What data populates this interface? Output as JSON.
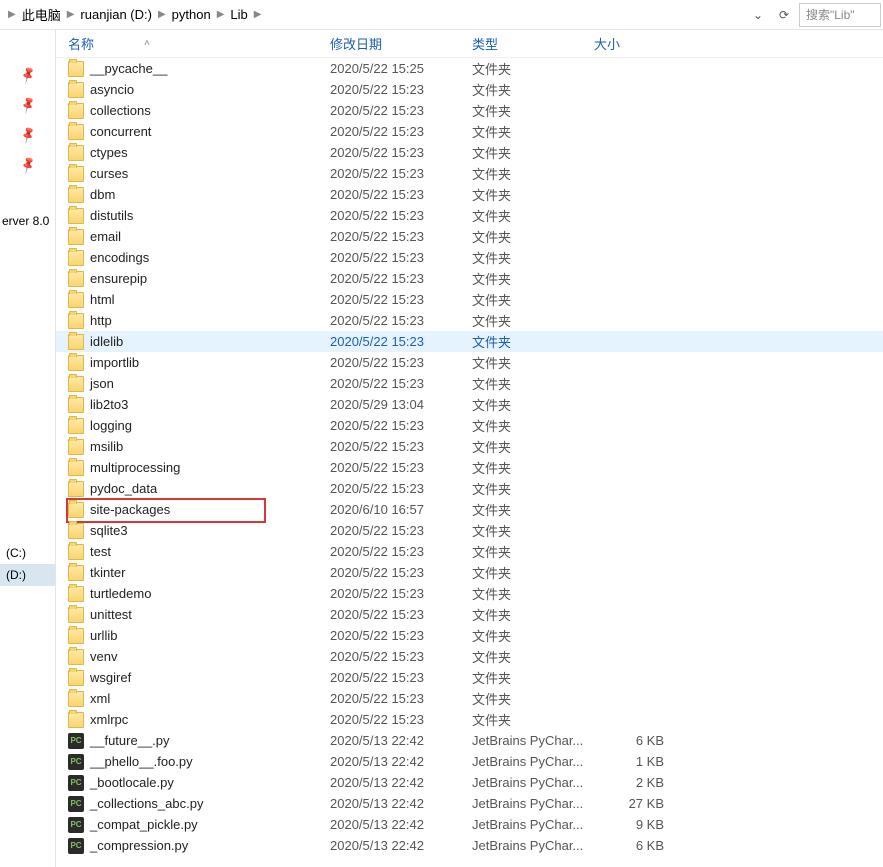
{
  "breadcrumb": [
    "此电脑",
    "ruanjian (D:)",
    "python",
    "Lib"
  ],
  "search_placeholder": "搜索\"Lib\"",
  "sidebar": {
    "label": "erver 8.0",
    "drives": [
      "(C:)",
      "(D:)"
    ],
    "selected_drive": 1
  },
  "columns": {
    "name": "名称",
    "date": "修改日期",
    "type": "类型",
    "size": "大小"
  },
  "items": [
    {
      "name": "__pycache__",
      "date": "2020/5/22 15:25",
      "type": "文件夹",
      "size": "",
      "kind": "folder"
    },
    {
      "name": "asyncio",
      "date": "2020/5/22 15:23",
      "type": "文件夹",
      "size": "",
      "kind": "folder"
    },
    {
      "name": "collections",
      "date": "2020/5/22 15:23",
      "type": "文件夹",
      "size": "",
      "kind": "folder"
    },
    {
      "name": "concurrent",
      "date": "2020/5/22 15:23",
      "type": "文件夹",
      "size": "",
      "kind": "folder"
    },
    {
      "name": "ctypes",
      "date": "2020/5/22 15:23",
      "type": "文件夹",
      "size": "",
      "kind": "folder"
    },
    {
      "name": "curses",
      "date": "2020/5/22 15:23",
      "type": "文件夹",
      "size": "",
      "kind": "folder"
    },
    {
      "name": "dbm",
      "date": "2020/5/22 15:23",
      "type": "文件夹",
      "size": "",
      "kind": "folder"
    },
    {
      "name": "distutils",
      "date": "2020/5/22 15:23",
      "type": "文件夹",
      "size": "",
      "kind": "folder"
    },
    {
      "name": "email",
      "date": "2020/5/22 15:23",
      "type": "文件夹",
      "size": "",
      "kind": "folder"
    },
    {
      "name": "encodings",
      "date": "2020/5/22 15:23",
      "type": "文件夹",
      "size": "",
      "kind": "folder"
    },
    {
      "name": "ensurepip",
      "date": "2020/5/22 15:23",
      "type": "文件夹",
      "size": "",
      "kind": "folder"
    },
    {
      "name": "html",
      "date": "2020/5/22 15:23",
      "type": "文件夹",
      "size": "",
      "kind": "folder"
    },
    {
      "name": "http",
      "date": "2020/5/22 15:23",
      "type": "文件夹",
      "size": "",
      "kind": "folder"
    },
    {
      "name": "idlelib",
      "date": "2020/5/22 15:23",
      "type": "文件夹",
      "size": "",
      "kind": "folder",
      "hover": true
    },
    {
      "name": "importlib",
      "date": "2020/5/22 15:23",
      "type": "文件夹",
      "size": "",
      "kind": "folder"
    },
    {
      "name": "json",
      "date": "2020/5/22 15:23",
      "type": "文件夹",
      "size": "",
      "kind": "folder"
    },
    {
      "name": "lib2to3",
      "date": "2020/5/29 13:04",
      "type": "文件夹",
      "size": "",
      "kind": "folder"
    },
    {
      "name": "logging",
      "date": "2020/5/22 15:23",
      "type": "文件夹",
      "size": "",
      "kind": "folder"
    },
    {
      "name": "msilib",
      "date": "2020/5/22 15:23",
      "type": "文件夹",
      "size": "",
      "kind": "folder"
    },
    {
      "name": "multiprocessing",
      "date": "2020/5/22 15:23",
      "type": "文件夹",
      "size": "",
      "kind": "folder"
    },
    {
      "name": "pydoc_data",
      "date": "2020/5/22 15:23",
      "type": "文件夹",
      "size": "",
      "kind": "folder"
    },
    {
      "name": "site-packages",
      "date": "2020/6/10 16:57",
      "type": "文件夹",
      "size": "",
      "kind": "folder",
      "boxed": true
    },
    {
      "name": "sqlite3",
      "date": "2020/5/22 15:23",
      "type": "文件夹",
      "size": "",
      "kind": "folder"
    },
    {
      "name": "test",
      "date": "2020/5/22 15:23",
      "type": "文件夹",
      "size": "",
      "kind": "folder"
    },
    {
      "name": "tkinter",
      "date": "2020/5/22 15:23",
      "type": "文件夹",
      "size": "",
      "kind": "folder"
    },
    {
      "name": "turtledemo",
      "date": "2020/5/22 15:23",
      "type": "文件夹",
      "size": "",
      "kind": "folder"
    },
    {
      "name": "unittest",
      "date": "2020/5/22 15:23",
      "type": "文件夹",
      "size": "",
      "kind": "folder"
    },
    {
      "name": "urllib",
      "date": "2020/5/22 15:23",
      "type": "文件夹",
      "size": "",
      "kind": "folder"
    },
    {
      "name": "venv",
      "date": "2020/5/22 15:23",
      "type": "文件夹",
      "size": "",
      "kind": "folder"
    },
    {
      "name": "wsgiref",
      "date": "2020/5/22 15:23",
      "type": "文件夹",
      "size": "",
      "kind": "folder"
    },
    {
      "name": "xml",
      "date": "2020/5/22 15:23",
      "type": "文件夹",
      "size": "",
      "kind": "folder"
    },
    {
      "name": "xmlrpc",
      "date": "2020/5/22 15:23",
      "type": "文件夹",
      "size": "",
      "kind": "folder"
    },
    {
      "name": "__future__.py",
      "date": "2020/5/13 22:42",
      "type": "JetBrains PyChar...",
      "size": "6 KB",
      "kind": "py"
    },
    {
      "name": "__phello__.foo.py",
      "date": "2020/5/13 22:42",
      "type": "JetBrains PyChar...",
      "size": "1 KB",
      "kind": "py"
    },
    {
      "name": "_bootlocale.py",
      "date": "2020/5/13 22:42",
      "type": "JetBrains PyChar...",
      "size": "2 KB",
      "kind": "py"
    },
    {
      "name": "_collections_abc.py",
      "date": "2020/5/13 22:42",
      "type": "JetBrains PyChar...",
      "size": "27 KB",
      "kind": "py"
    },
    {
      "name": "_compat_pickle.py",
      "date": "2020/5/13 22:42",
      "type": "JetBrains PyChar...",
      "size": "9 KB",
      "kind": "py"
    },
    {
      "name": "_compression.py",
      "date": "2020/5/13 22:42",
      "type": "JetBrains PyChar...",
      "size": "6 KB",
      "kind": "py"
    }
  ]
}
